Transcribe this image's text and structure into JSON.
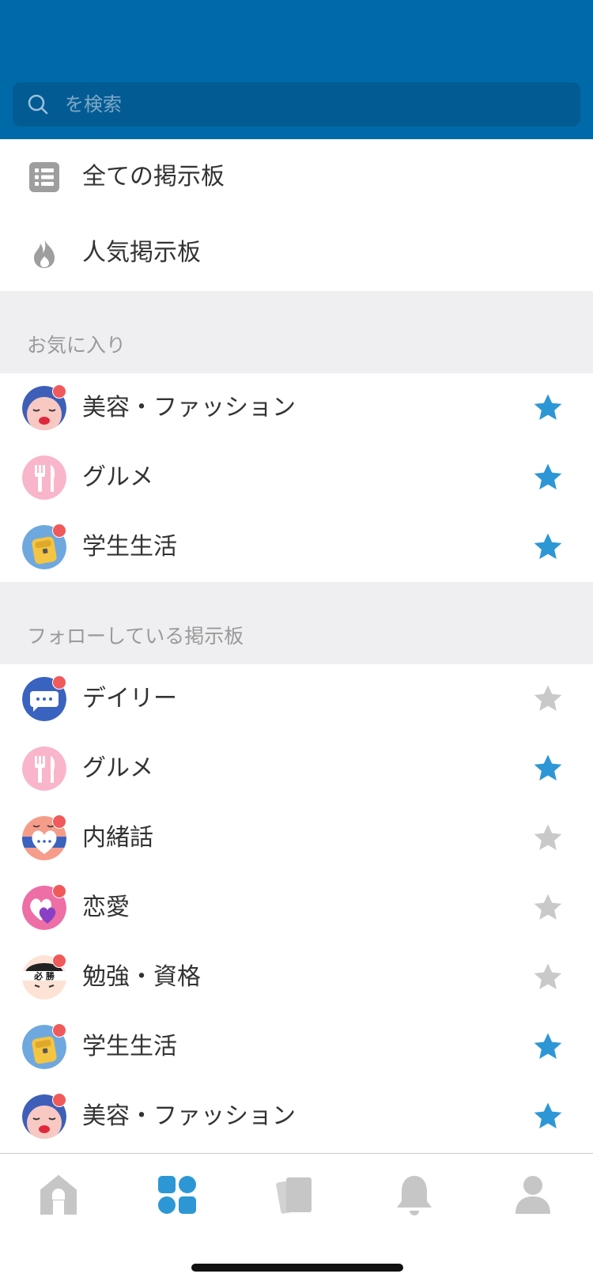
{
  "search": {
    "placeholder": "を検索"
  },
  "menu": [
    {
      "label": "全ての掲示板",
      "icon": "list-icon"
    },
    {
      "label": "人気掲示板",
      "icon": "flame-icon"
    }
  ],
  "sections": {
    "favorites": {
      "title": "お気に入り",
      "items": [
        {
          "label": "美容・ファッション",
          "avatar": "beauty-avatar-icon",
          "badge": true,
          "starred": true
        },
        {
          "label": "グルメ",
          "avatar": "gourmet-avatar-icon",
          "badge": false,
          "starred": true
        },
        {
          "label": "学生生活",
          "avatar": "student-life-avatar-icon",
          "badge": true,
          "starred": true
        }
      ]
    },
    "following": {
      "title": "フォローしている掲示板",
      "items": [
        {
          "label": "デイリー",
          "avatar": "daily-avatar-icon",
          "badge": true,
          "starred": false
        },
        {
          "label": "グルメ",
          "avatar": "gourmet-avatar-icon",
          "badge": false,
          "starred": true
        },
        {
          "label": "内緒話",
          "avatar": "secret-avatar-icon",
          "badge": true,
          "starred": false
        },
        {
          "label": "恋愛",
          "avatar": "love-avatar-icon",
          "badge": true,
          "starred": false
        },
        {
          "label": "勉強・資格",
          "avatar": "study-avatar-icon",
          "badge": true,
          "starred": false,
          "avatar_text": "必 勝"
        },
        {
          "label": "学生生活",
          "avatar": "student-life-avatar-icon",
          "badge": true,
          "starred": true
        },
        {
          "label": "美容・ファッション",
          "avatar": "beauty-avatar-icon",
          "badge": true,
          "starred": true
        }
      ]
    }
  },
  "tabbar": [
    {
      "name": "home-tab",
      "icon": "home-icon",
      "active": false
    },
    {
      "name": "boards-tab",
      "icon": "grid-icon",
      "active": true
    },
    {
      "name": "cards-tab",
      "icon": "cards-icon",
      "active": false
    },
    {
      "name": "notifications-tab",
      "icon": "bell-icon",
      "active": false
    },
    {
      "name": "profile-tab",
      "icon": "person-icon",
      "active": false
    }
  ],
  "colors": {
    "header": "#006aa8",
    "search_bg": "#025c93",
    "star_active": "#2d97d6",
    "star_inactive": "#c9c9c9",
    "tab_active": "#2d97d6",
    "tab_inactive": "#c6c6c6",
    "badge": "#f05a5b"
  }
}
